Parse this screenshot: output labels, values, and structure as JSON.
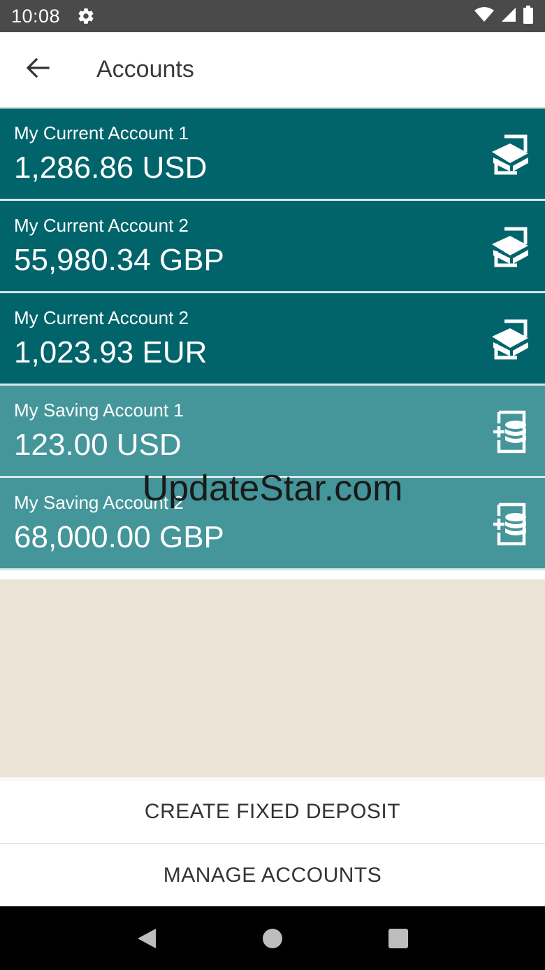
{
  "status_bar": {
    "time": "10:08",
    "icons": [
      "settings-gear-icon",
      "wifi-icon",
      "cellular-signal-icon",
      "battery-icon"
    ]
  },
  "app_bar": {
    "title": "Accounts",
    "back_icon": "arrow-left-icon"
  },
  "accounts": [
    {
      "name": "My Current Account 1",
      "balance": "1,286.86 USD",
      "type": "current",
      "icon": "transfer-icon"
    },
    {
      "name": "My Current Account 2",
      "balance": "55,980.34 GBP",
      "type": "current",
      "icon": "transfer-icon"
    },
    {
      "name": "My Current Account 2",
      "balance": "1,023.93 EUR",
      "type": "current",
      "icon": "transfer-icon"
    },
    {
      "name": "My Saving Account 1",
      "balance": "123.00 USD",
      "type": "saving",
      "icon": "savings-coins-icon"
    },
    {
      "name": "My Saving Account 2",
      "balance": "68,000.00 GBP",
      "type": "saving",
      "icon": "savings-coins-icon"
    }
  ],
  "watermark": "UpdateStar.com",
  "actions": {
    "create_fixed_deposit": "CREATE FIXED DEPOSIT",
    "manage_accounts": "MANAGE ACCOUNTS"
  },
  "nav_bar": {
    "icons": [
      "back-triangle-icon",
      "home-circle-icon",
      "recents-square-icon"
    ]
  },
  "colors": {
    "current_account_bg": "#02646b",
    "saving_account_bg": "#44969a",
    "empty_area_bg": "#ebe3d6",
    "status_bar_bg": "#4a4a4a"
  }
}
